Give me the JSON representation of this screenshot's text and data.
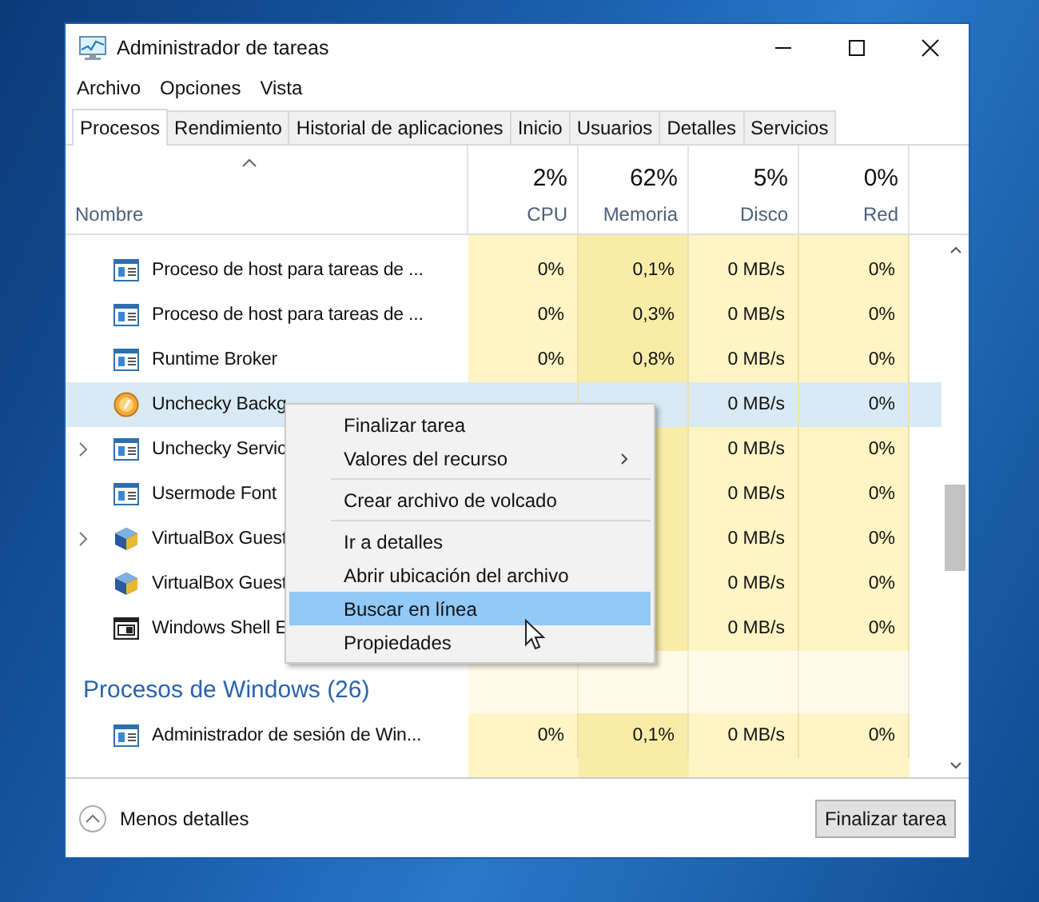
{
  "window": {
    "title": "Administrador de tareas"
  },
  "menu": [
    "Archivo",
    "Opciones",
    "Vista"
  ],
  "tabs": [
    {
      "label": "Procesos",
      "selected": true
    },
    {
      "label": "Rendimiento",
      "selected": false
    },
    {
      "label": "Historial de aplicaciones",
      "selected": false
    },
    {
      "label": "Inicio",
      "selected": false
    },
    {
      "label": "Usuarios",
      "selected": false
    },
    {
      "label": "Detalles",
      "selected": false
    },
    {
      "label": "Servicios",
      "selected": false
    }
  ],
  "name_column": "Nombre",
  "columns": [
    {
      "usage": "2%",
      "label": "CPU"
    },
    {
      "usage": "62%",
      "label": "Memoria"
    },
    {
      "usage": "5%",
      "label": "Disco"
    },
    {
      "usage": "0%",
      "label": "Red"
    }
  ],
  "rows": [
    {
      "kind": "app",
      "name": "Proceso de host para tareas de ...",
      "selected": false,
      "cpu": "0%",
      "memory": "0,1%",
      "disk": "0 MB/s",
      "network": "0%"
    },
    {
      "kind": "app",
      "name": "Proceso de host para tareas de ...",
      "selected": false,
      "cpu": "0%",
      "memory": "0,3%",
      "disk": "0 MB/s",
      "network": "0%"
    },
    {
      "kind": "app",
      "name": "Runtime Broker",
      "selected": false,
      "cpu": "0%",
      "memory": "0,8%",
      "disk": "0 MB/s",
      "network": "0%"
    },
    {
      "kind": "unchecky",
      "name": "Unchecky Backg",
      "selected": true,
      "disk": "0 MB/s",
      "network": "0%"
    },
    {
      "kind": "app",
      "name": "Unchecky Servic",
      "expandable": true,
      "selected": false,
      "disk": "0 MB/s",
      "network": "0%"
    },
    {
      "kind": "app",
      "name": "Usermode Font",
      "selected": false,
      "disk": "0 MB/s",
      "network": "0%"
    },
    {
      "kind": "vbox",
      "name": "VirtualBox Guest",
      "expandable": true,
      "selected": false,
      "disk": "0 MB/s",
      "network": "0%"
    },
    {
      "kind": "vbox",
      "name": "VirtualBox Guest",
      "selected": false,
      "disk": "0 MB/s",
      "network": "0%"
    },
    {
      "kind": "shell",
      "name": "Windows Shell E",
      "selected": false,
      "disk": "0 MB/s",
      "network": "0%"
    }
  ],
  "windows_group": {
    "title": "Procesos de Windows (26)",
    "rows": [
      {
        "kind": "app",
        "name": "Administrador de sesión de Win...",
        "selected": false,
        "cpu": "0%",
        "memory": "0,1%",
        "disk": "0 MB/s",
        "network": "0%"
      }
    ]
  },
  "context_menu": {
    "items": [
      {
        "kind": "item",
        "label": "Finalizar tarea",
        "submenu": false,
        "selected": false
      },
      {
        "kind": "item",
        "label": "Valores del recurso",
        "submenu": true,
        "selected": false
      },
      {
        "kind": "separator"
      },
      {
        "kind": "item",
        "label": "Crear archivo de volcado",
        "submenu": false,
        "selected": false
      },
      {
        "kind": "separator"
      },
      {
        "kind": "item",
        "label": "Ir a detalles",
        "submenu": false,
        "selected": false
      },
      {
        "kind": "item",
        "label": "Abrir ubicación del archivo",
        "submenu": false,
        "selected": false
      },
      {
        "kind": "item",
        "label": "Buscar en línea",
        "submenu": false,
        "selected": true
      },
      {
        "kind": "item",
        "label": "Propiedades",
        "submenu": false,
        "selected": false
      }
    ]
  },
  "footer": {
    "toggle": "Menos detalles",
    "button": "Finalizar tarea"
  }
}
